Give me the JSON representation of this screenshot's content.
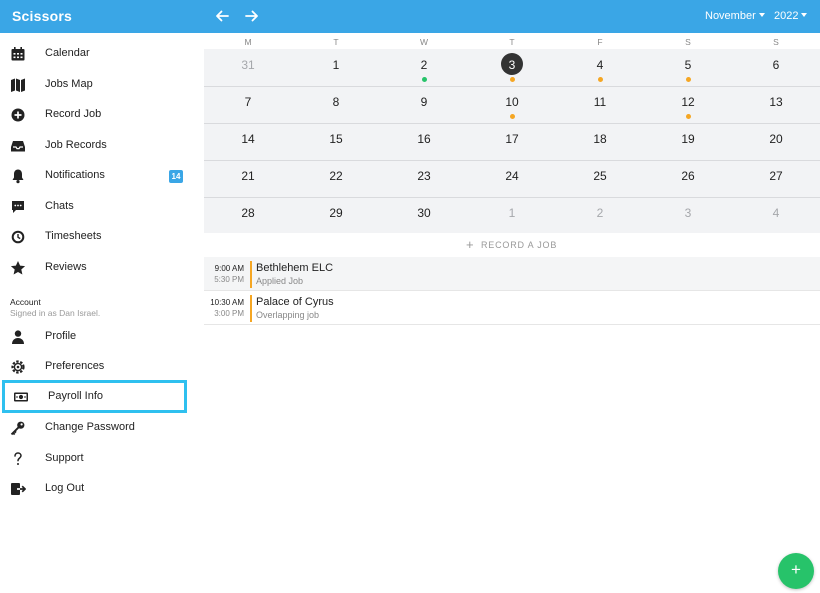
{
  "app": {
    "title": "Scissors"
  },
  "header": {
    "month": "November",
    "year": "2022"
  },
  "sidebar": {
    "items": [
      {
        "label": "Calendar",
        "icon": "calendar-icon"
      },
      {
        "label": "Jobs Map",
        "icon": "map-icon"
      },
      {
        "label": "Record Job",
        "icon": "plus-circle-icon"
      },
      {
        "label": "Job Records",
        "icon": "inbox-tray-icon"
      },
      {
        "label": "Notifications",
        "icon": "bell-icon",
        "badge": "14"
      },
      {
        "label": "Chats",
        "icon": "chat-bubble-icon"
      },
      {
        "label": "Timesheets",
        "icon": "clock-icon"
      },
      {
        "label": "Reviews",
        "icon": "star-icon"
      }
    ],
    "account": {
      "heading": "Account",
      "subheading": "Signed in as Dan Israel.",
      "items": [
        {
          "label": "Profile",
          "icon": "person-icon"
        },
        {
          "label": "Preferences",
          "icon": "gear-icon"
        },
        {
          "label": "Payroll Info",
          "icon": "money-icon",
          "highlighted": true
        },
        {
          "label": "Change Password",
          "icon": "key-icon"
        },
        {
          "label": "Support",
          "icon": "question-icon"
        },
        {
          "label": "Log Out",
          "icon": "logout-icon"
        }
      ]
    }
  },
  "calendar": {
    "weekdays": [
      "M",
      "T",
      "W",
      "T",
      "F",
      "S",
      "S"
    ],
    "weeks": [
      [
        {
          "d": "31",
          "muted": true
        },
        {
          "d": "1"
        },
        {
          "d": "2",
          "dot": "green"
        },
        {
          "d": "3",
          "today": true,
          "dot": "orange"
        },
        {
          "d": "4",
          "dot": "orange"
        },
        {
          "d": "5",
          "dot": "orange"
        },
        {
          "d": "6"
        }
      ],
      [
        {
          "d": "7"
        },
        {
          "d": "8"
        },
        {
          "d": "9"
        },
        {
          "d": "10",
          "dot": "orange"
        },
        {
          "d": "11"
        },
        {
          "d": "12",
          "dot": "orange"
        },
        {
          "d": "13"
        }
      ],
      [
        {
          "d": "14"
        },
        {
          "d": "15"
        },
        {
          "d": "16"
        },
        {
          "d": "17"
        },
        {
          "d": "18"
        },
        {
          "d": "19"
        },
        {
          "d": "20"
        }
      ],
      [
        {
          "d": "21"
        },
        {
          "d": "22"
        },
        {
          "d": "23"
        },
        {
          "d": "24"
        },
        {
          "d": "25"
        },
        {
          "d": "26"
        },
        {
          "d": "27"
        }
      ],
      [
        {
          "d": "28"
        },
        {
          "d": "29"
        },
        {
          "d": "30"
        },
        {
          "d": "1",
          "muted": true
        },
        {
          "d": "2",
          "muted": true
        },
        {
          "d": "3",
          "muted": true
        },
        {
          "d": "4",
          "muted": true
        }
      ]
    ]
  },
  "record_job": {
    "label": "RECORD A JOB"
  },
  "jobs": [
    {
      "start": "9:00 AM",
      "end": "5:30 PM",
      "name": "Bethlehem ELC",
      "status": "Applied Job"
    },
    {
      "start": "10:30 AM",
      "end": "3:00 PM",
      "name": "Palace of Cyrus",
      "status": "Overlapping job"
    }
  ],
  "fab": {
    "label": "+"
  },
  "colors": {
    "accent": "#3aa6e6",
    "highlight_border": "#2fc0ef",
    "dot_green": "#27c36a",
    "dot_orange": "#f5a623",
    "job_bar": "#f5a623",
    "fab": "#27c36a"
  }
}
